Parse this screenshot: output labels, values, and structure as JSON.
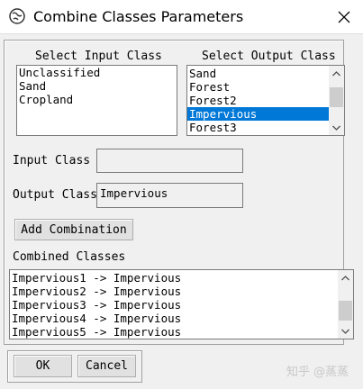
{
  "window": {
    "title": "Combine Classes Parameters",
    "close_glyph": "✕"
  },
  "input_class_list": {
    "label": "Select Input Class",
    "items": [
      "Unclassified",
      "Sand",
      "Cropland"
    ]
  },
  "output_class_list": {
    "label": "Select Output Class",
    "items": [
      "Sand",
      "Forest",
      "Forest2",
      "Impervious",
      "Forest3"
    ],
    "selected_index": 3
  },
  "fields": {
    "input_class_label": "Input Class",
    "input_class_value": "",
    "output_class_label": "Output Class",
    "output_class_value": "Impervious"
  },
  "buttons": {
    "add_combination": "Add Combination",
    "ok": "OK",
    "cancel": "Cancel"
  },
  "combined_classes": {
    "label": "Combined Classes",
    "items": [
      "Impervious1 -> Impervious",
      "Impervious2 -> Impervious",
      "Impervious3 -> Impervious",
      "Impervious4 -> Impervious",
      "Impervious5 -> Impervious"
    ]
  },
  "watermark": "知乎 @蒸蒸",
  "colors": {
    "selection": "#0078d7",
    "window_bg": "#f0f0f0"
  }
}
